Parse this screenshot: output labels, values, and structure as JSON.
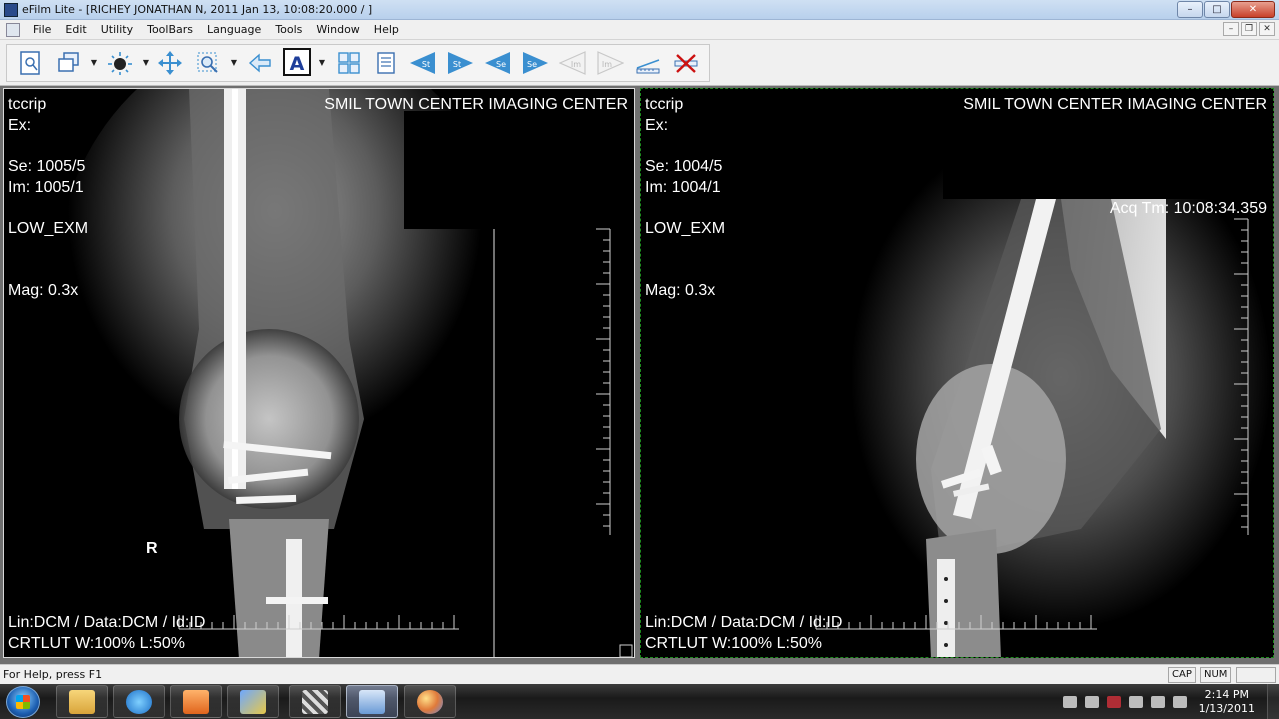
{
  "window": {
    "title": "eFilm Lite - [RICHEY JONATHAN N, 2011 Jan 13, 10:08:20.000  /  ]",
    "minimize": "–",
    "maximize": "□",
    "close": "✕"
  },
  "menu": {
    "items": [
      "File",
      "Edit",
      "Utility",
      "ToolBars",
      "Language",
      "Tools",
      "Window",
      "Help"
    ]
  },
  "toolbar": {
    "icons": [
      "report-icon",
      "series-icon",
      "window-level-icon",
      "pan-icon",
      "zoom-icon",
      "back-arrow-icon",
      "annotation-icon",
      "layout-icon",
      "notes-icon",
      "prev-study-icon",
      "next-study-icon",
      "prev-series-icon",
      "next-series-icon",
      "prev-image-icon",
      "next-image-icon",
      "ruler-icon",
      "delete-measure-icon"
    ],
    "labels": {
      "prev_study": "St",
      "next_study": "St",
      "prev_series": "Se",
      "next_series": "Se",
      "prev_image": "Im",
      "next_image": "Im"
    },
    "colors": {
      "nav_blue": "#3a8fd0",
      "nav_disabled": "#c8c8c8",
      "accent_red": "#cc1111"
    }
  },
  "viewports": [
    {
      "patient": "tccrip",
      "exam": "Ex:",
      "series": "Se: 1005/5",
      "image": "Im: 1005/1",
      "protocol": "LOW_EXM",
      "magnification": "Mag: 0.3x",
      "institution": "SMIL TOWN CENTER IMAGING CENTER",
      "marker": "R",
      "lut_info": "Lin:DCM / Data:DCM / Id:ID",
      "window_info": "CRTLUT W:100%  L:50%"
    },
    {
      "patient": "tccrip",
      "exam": "Ex:",
      "series": "Se: 1004/5",
      "image": "Im: 1004/1",
      "protocol": "LOW_EXM",
      "magnification": "Mag: 0.3x",
      "institution": "SMIL TOWN CENTER IMAGING CENTER",
      "acq_time": "Acq Tm: 10:08:34.359",
      "lut_info": "Lin:DCM / Data:DCM / Id:ID",
      "window_info": "CRTLUT W:100%  L:50%"
    }
  ],
  "status": {
    "help_text": "For Help, press F1",
    "caps": "CAP",
    "num": "NUM"
  },
  "taskbar": {
    "apps": [
      "explorer-icon",
      "internet-explorer-icon",
      "media-player-icon",
      "network-tool-icon",
      "film-reel-icon",
      "efilm-icon",
      "paint-icon"
    ],
    "active_index": 5,
    "time": "2:14 PM",
    "date": "1/13/2011"
  }
}
